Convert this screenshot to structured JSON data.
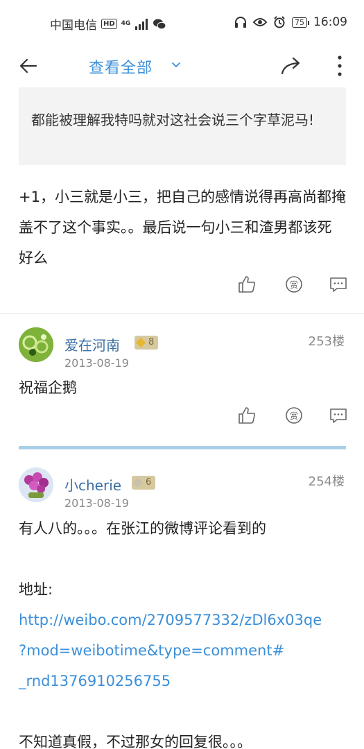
{
  "status_bar": {
    "carrier": "中国电信",
    "hd": "HD",
    "network": "4G",
    "battery": "75",
    "time": "16:09"
  },
  "nav": {
    "title": "查看全部"
  },
  "quote": {
    "text": "都能被理解我特吗就对这社会说三个字草泥马!"
  },
  "reply_main": {
    "text": "+1，小三就是小三，把自己的感情说得再高尚都掩盖不了这个事实。。最后说一句小三和渣男都该死好么"
  },
  "posts": [
    {
      "username": "爱在河南",
      "level": "8",
      "floor": "253楼",
      "date": "2013-08-19",
      "text": "祝福企鹅"
    },
    {
      "username": "小cherie",
      "level": "6",
      "floor": "254楼",
      "date": "2013-08-19",
      "line1": "有人八的。。。在张江的微博评论看到的",
      "addr_label": "地址:",
      "link_1": "http://weibo.com/2709577332/zDl6x03qe",
      "link_2": "?mod=weibotime&type=comment#",
      "link_3": "_rnd1376910256755",
      "line_last": "不知道真假，不过那女的回复很。。。"
    }
  ],
  "actions": {
    "reward_glyph": "赏"
  },
  "icons": [
    "back-arrow-icon",
    "chevron-down-icon",
    "share-icon",
    "more-icon",
    "like-icon",
    "reward-icon",
    "comment-icon",
    "headphones-icon",
    "eye-icon",
    "alarm-icon",
    "wechat-icon",
    "signal-icon"
  ]
}
